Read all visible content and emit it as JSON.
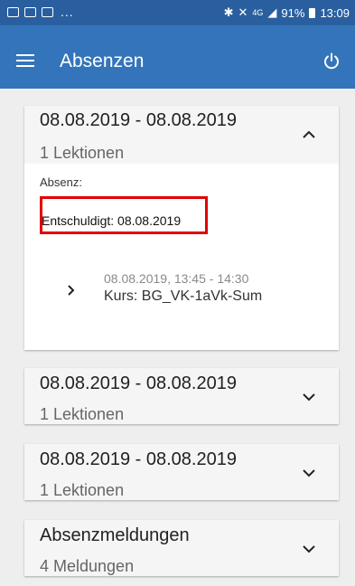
{
  "statusbar": {
    "dots": "...",
    "icons": [
      "image-icon",
      "mail-icon",
      "chat-icon",
      "bluetooth-icon",
      "mute-icon",
      "signal-icon"
    ],
    "network": "4G",
    "battery": "91%",
    "time": "13:09"
  },
  "appbar": {
    "title": "Absenzen"
  },
  "cards": [
    {
      "title": "08.08.2019 - 08.08.2019",
      "subtitle": "1 Lektionen",
      "expanded": true,
      "absenz_label": "Absenz:",
      "entschuldigt": "Entschuldigt: 08.08.2019",
      "lesson": {
        "datetime": "08.08.2019, 13:45 - 14:30",
        "kurs": "Kurs: BG_VK-1aVk-Sum"
      }
    },
    {
      "title": "08.08.2019 - 08.08.2019",
      "subtitle": "1 Lektionen",
      "expanded": false
    },
    {
      "title": "08.08.2019 - 08.08.2019",
      "subtitle": "1 Lektionen",
      "expanded": false
    },
    {
      "title": "Absenzmeldungen",
      "subtitle": "4 Meldungen",
      "expanded": false
    }
  ],
  "colors": {
    "statusbar": "#2a5f9f",
    "appbar": "#3474ba",
    "background": "#eeeeee",
    "highlight": "#e10000"
  }
}
